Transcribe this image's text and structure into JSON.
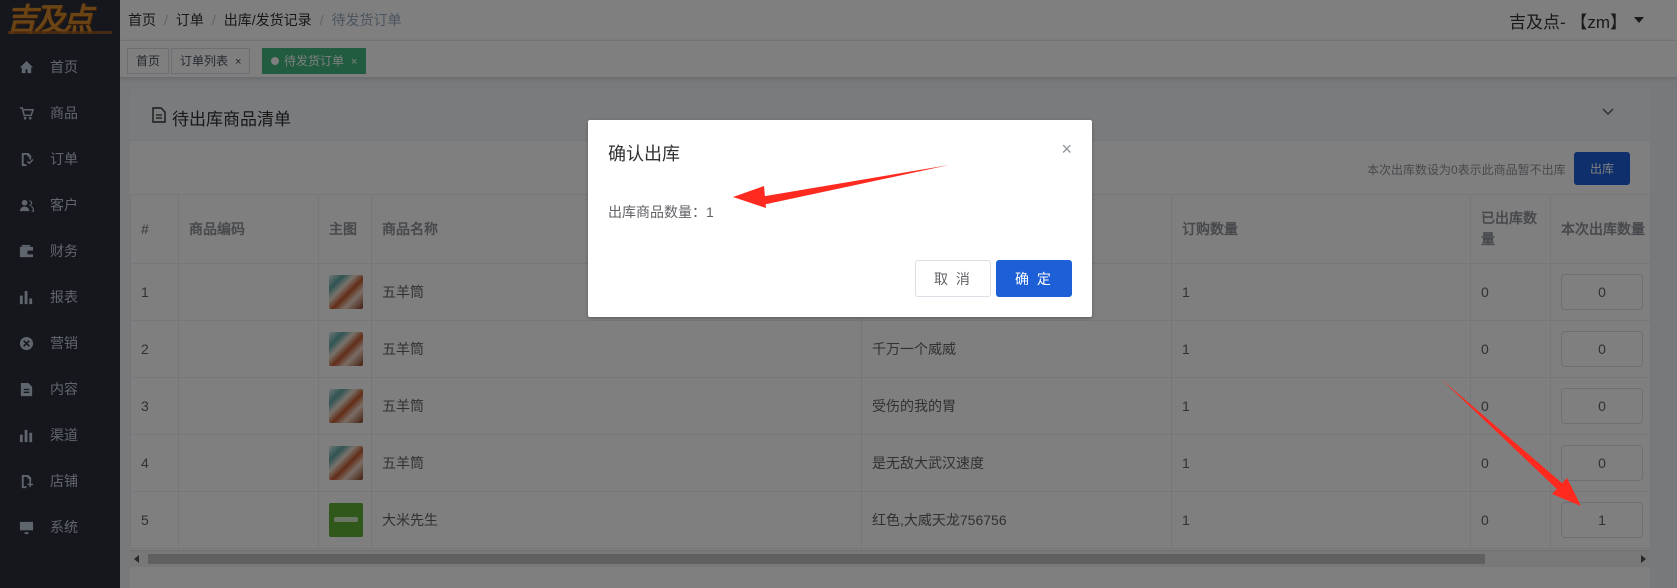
{
  "app": {
    "logo_text": "吉及点",
    "accent_color": "#1d5fd6",
    "tag_active_color": "#42b983",
    "sidebar_bg": "#2b2f3a"
  },
  "sidebar": {
    "items": [
      {
        "label": "首页",
        "icon": "home-icon"
      },
      {
        "label": "商品",
        "icon": "cart-icon"
      },
      {
        "label": "订单",
        "icon": "order-icon"
      },
      {
        "label": "客户",
        "icon": "user-icon"
      },
      {
        "label": "财务",
        "icon": "wallet-icon"
      },
      {
        "label": "报表",
        "icon": "bar-chart-icon"
      },
      {
        "label": "营销",
        "icon": "marketing-icon"
      },
      {
        "label": "内容",
        "icon": "content-icon"
      },
      {
        "label": "渠道",
        "icon": "channel-icon"
      },
      {
        "label": "店铺",
        "icon": "shop-icon"
      },
      {
        "label": "系统",
        "icon": "monitor-icon"
      }
    ]
  },
  "header": {
    "breadcrumb": [
      "首页",
      "订单",
      "出库/发货记录",
      "待发货订单"
    ],
    "user": "吉及点- 【zm】"
  },
  "tags": [
    {
      "label": "首页",
      "closable": false,
      "active": false
    },
    {
      "label": "订单列表",
      "closable": true,
      "active": false
    },
    {
      "label": "待发货订单",
      "closable": true,
      "active": true
    }
  ],
  "tag_close": "×",
  "panel": {
    "title": "待出库商品清单",
    "hint": "本次出库数设为0表示此商品暂不出库",
    "ship_button": "出库"
  },
  "table": {
    "columns": [
      "#",
      "商品编码",
      "主图",
      "商品名称",
      "",
      "订购数量",
      "已出库数量",
      "本次出库数量"
    ],
    "rows": [
      {
        "index": "1",
        "code": "",
        "image": "straw-product",
        "name": "五羊筒",
        "spec": "",
        "ordered": "1",
        "shipped": "0",
        "qty": "0"
      },
      {
        "index": "2",
        "code": "",
        "image": "straw-product",
        "name": "五羊筒",
        "spec": "千万一个威威",
        "ordered": "1",
        "shipped": "0",
        "qty": "0"
      },
      {
        "index": "3",
        "code": "",
        "image": "straw-product",
        "name": "五羊筒",
        "spec": "受伤的我的胃",
        "ordered": "1",
        "shipped": "0",
        "qty": "0"
      },
      {
        "index": "4",
        "code": "",
        "image": "straw-product",
        "name": "五羊筒",
        "spec": "是无敌大武汉速度",
        "ordered": "1",
        "shipped": "0",
        "qty": "0"
      },
      {
        "index": "5",
        "code": "",
        "image": "rice-product",
        "name": "大米先生",
        "spec": "红色,大威天龙756756",
        "ordered": "1",
        "shipped": "0",
        "qty": "1"
      }
    ]
  },
  "dialog": {
    "title": "确认出库",
    "body": "出库商品数量：1",
    "cancel": "取 消",
    "ok": "确 定",
    "close": "×"
  },
  "annotation_color": "#ff2a1f"
}
